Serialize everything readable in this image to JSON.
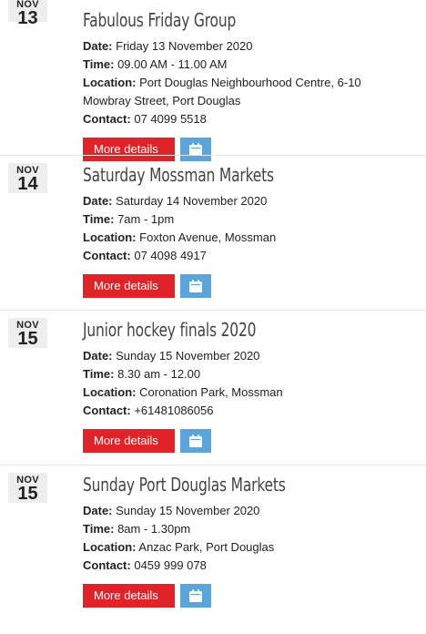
{
  "labels": {
    "date": "Date:",
    "time": "Time:",
    "location": "Location:",
    "contact": "Contact:",
    "more_details": "More details"
  },
  "events": [
    {
      "month": "NOV",
      "day": "13",
      "title": "Fabulous Friday Group",
      "date": "Friday 13 November 2020",
      "time": "09.00 AM - 11.00 AM",
      "location": "Port Douglas Neighbourhood Centre, 6-10 Mowbray Street, Port Douglas",
      "contact": "07 4099 5518"
    },
    {
      "month": "NOV",
      "day": "14",
      "title": "Saturday Mossman Markets",
      "date": "Saturday 14 November 2020",
      "time": "7am - 1pm",
      "location": "Foxton Avenue, Mossman",
      "contact": "07 4098 4917"
    },
    {
      "month": "NOV",
      "day": "15",
      "title": "Junior hockey finals 2020",
      "date": "Sunday 15 November 2020",
      "time": "8.30 am - 12.00",
      "location": "Coronation Park, Mossman",
      "contact": "+61481086056"
    },
    {
      "month": "NOV",
      "day": "15",
      "title": "Sunday Port Douglas Markets",
      "date": "Sunday 15 November 2020",
      "time": "8am - 1.30pm",
      "location": "Anzac Park, Port Douglas",
      "contact": "0459 999 078"
    }
  ],
  "colors": {
    "more_button": "#e02328",
    "calendar_button": "#5ca5db",
    "date_box": "#eeeeee"
  },
  "icons": {
    "calendar": "calendar-icon"
  }
}
